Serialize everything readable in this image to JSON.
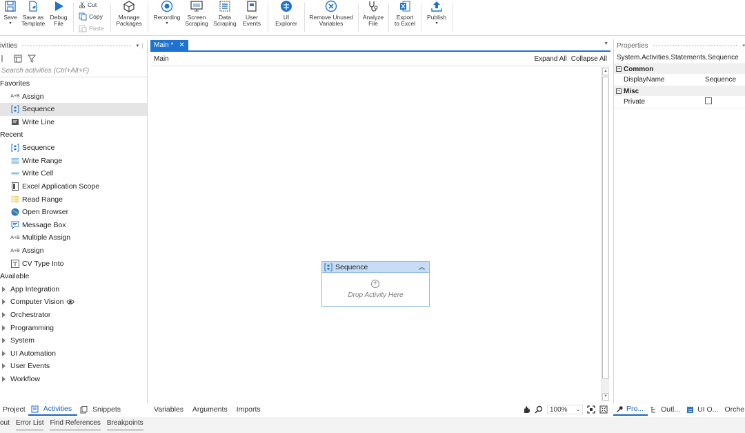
{
  "ribbon": {
    "save": "Save",
    "save_as_template": "Save as\nTemplate",
    "debug_file": "Debug\nFile",
    "cut": "Cut",
    "copy": "Copy",
    "paste": "Paste",
    "manage_packages": "Manage\nPackages",
    "recording": "Recording",
    "screen_scraping": "Screen\nScraping",
    "data_scraping": "Data\nScraping",
    "user_events": "User\nEvents",
    "ui_explorer": "UI\nExplorer",
    "remove_unused_variables": "Remove Unused\nVariables",
    "analyze_file": "Analyze\nFile",
    "export_to_excel": "Export\nto Excel",
    "publish": "Publish"
  },
  "activities": {
    "header": "ivities",
    "search_placeholder": "Search activities (Ctrl+Alt+F)",
    "favorites_label": "Favorites",
    "favorites": [
      "Assign",
      "Sequence",
      "Write Line"
    ],
    "recent_label": "Recent",
    "recent": [
      "Sequence",
      "Write Range",
      "Write Cell",
      "Excel Application Scope",
      "Read Range",
      "Open Browser",
      "Message Box",
      "Multiple Assign",
      "Assign",
      "CV Type Into"
    ],
    "available_label": "Available",
    "available": [
      "App Integration",
      "Computer Vision",
      "Orchestrator",
      "Programming",
      "System",
      "UI Automation",
      "User Events",
      "Workflow"
    ]
  },
  "left_tabs": [
    "Project",
    "Activities",
    "Snippets"
  ],
  "output_tabs": [
    "out",
    "Error List",
    "Find References",
    "Breakpoints"
  ],
  "designer": {
    "tab_title": "Main *",
    "breadcrumb": "Main",
    "expand_all": "Expand All",
    "collapse_all": "Collapse All",
    "sequence_title": "Sequence",
    "drop_hint": "Drop Activity Here",
    "bottom_tabs": [
      "Variables",
      "Arguments",
      "Imports"
    ],
    "zoom": "100%"
  },
  "properties": {
    "header": "Properties",
    "type_name": "System.Activities.Statements.Sequence",
    "categories": [
      {
        "name": "Common",
        "rows": [
          {
            "key": "DisplayName",
            "value": "Sequence"
          }
        ]
      },
      {
        "name": "Misc",
        "rows": [
          {
            "key": "Private",
            "value": ""
          }
        ]
      }
    ],
    "bottom_tabs": [
      "Pro...",
      "Outl...",
      "UI O...",
      "Orche"
    ]
  },
  "colors": {
    "accent": "#1e73d2",
    "sequence_header": "#c6ddf5"
  }
}
